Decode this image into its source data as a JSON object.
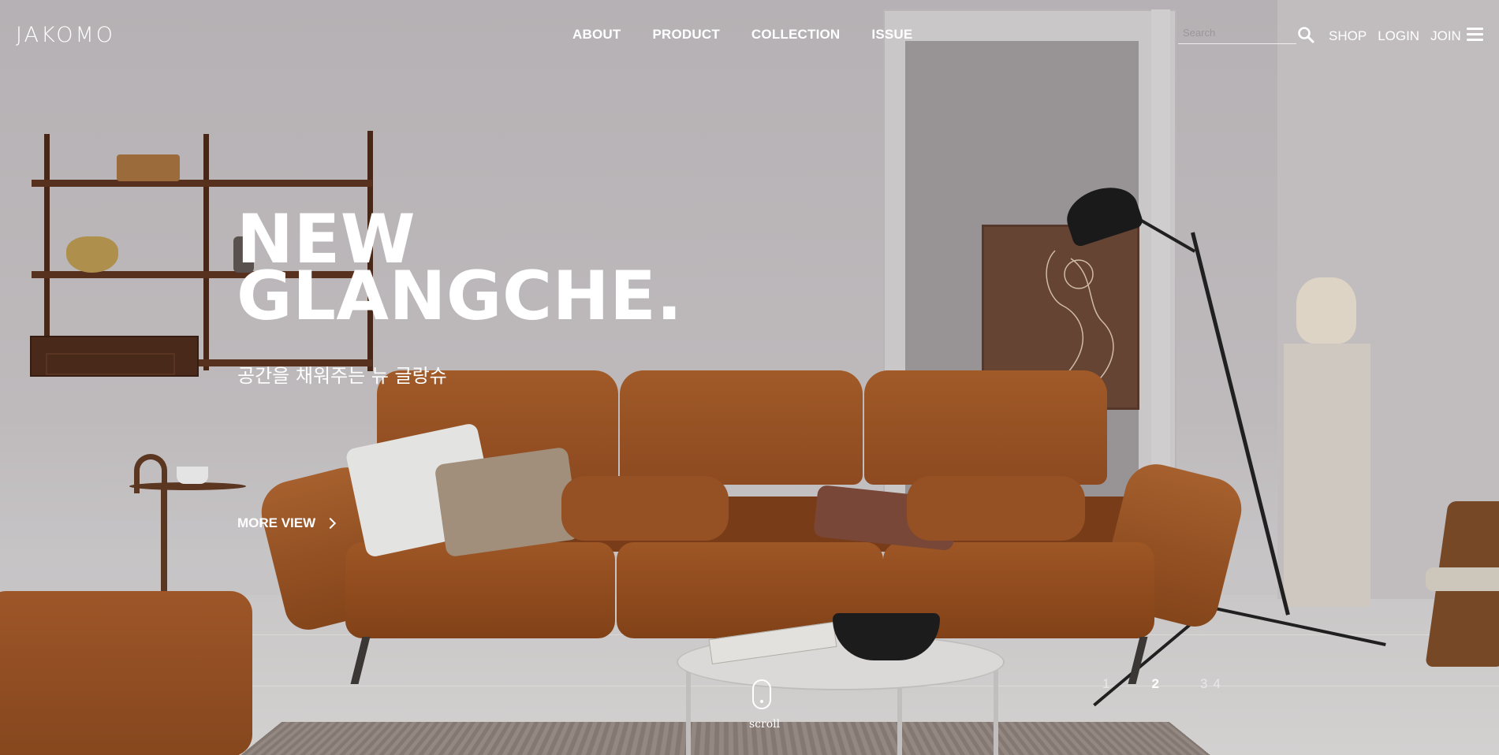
{
  "brand": {
    "logo": "JAKOMO"
  },
  "nav": {
    "items": [
      {
        "label": "ABOUT"
      },
      {
        "label": "PRODUCT"
      },
      {
        "label": "COLLECTION"
      },
      {
        "label": "ISSUE"
      }
    ]
  },
  "search": {
    "placeholder": "Search",
    "value": "",
    "icon": "search-icon"
  },
  "util": {
    "shop": "SHOP",
    "login": "LOGIN",
    "join": "JOIN",
    "menu_icon": "hamburger-menu-icon"
  },
  "hero": {
    "title_line1": "NEW",
    "title_line2": "GLANGCHE.",
    "subtitle": "공간을 채워주는 뉴 글랑슈",
    "cta": "MORE VIEW",
    "cta_icon": "chevron-right-icon"
  },
  "scroll": {
    "label": "scroll",
    "icon": "mouse-icon"
  },
  "pager": {
    "items": [
      "1",
      "2",
      "3",
      "4"
    ],
    "active": "2"
  },
  "colors": {
    "text": "#ffffff",
    "sofa": "#a05a28"
  }
}
